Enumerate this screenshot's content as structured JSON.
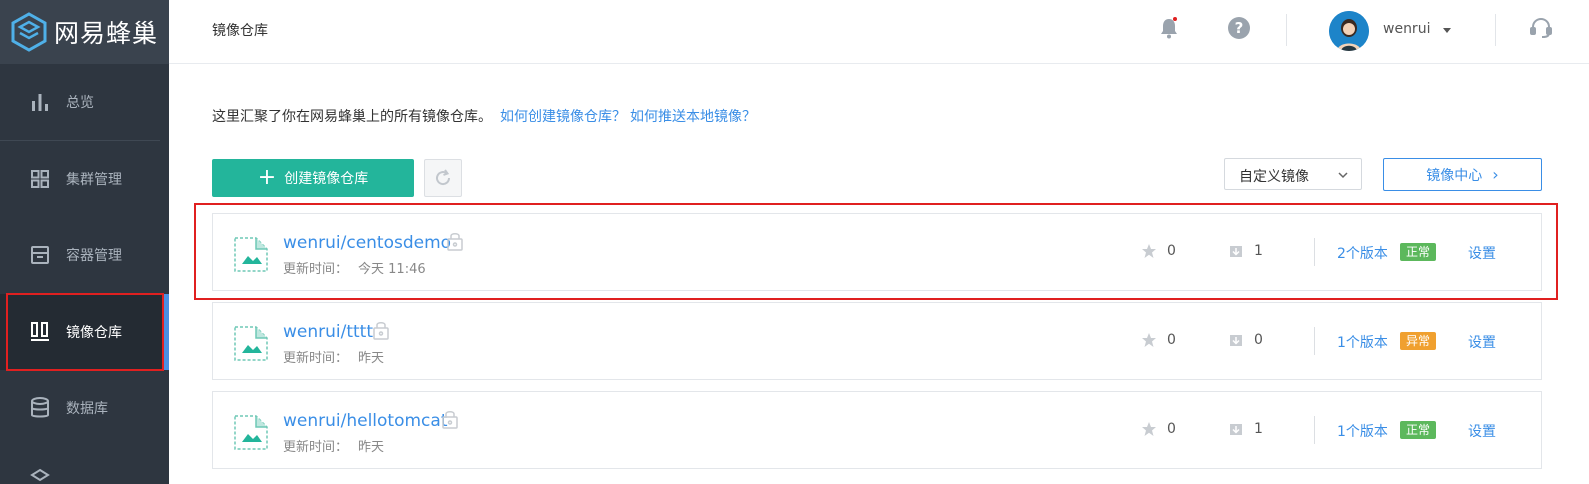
{
  "brand": {
    "name": "网易蜂巢"
  },
  "sidebar": {
    "items": [
      {
        "label": "总览",
        "icon": "bar-chart-icon"
      },
      {
        "label": "集群管理",
        "icon": "grid-icon"
      },
      {
        "label": "容器管理",
        "icon": "container-box-icon"
      },
      {
        "label": "镜像仓库",
        "icon": "image-repo-icon",
        "active": true
      },
      {
        "label": "数据库",
        "icon": "database-icon"
      }
    ]
  },
  "header": {
    "title": "镜像仓库",
    "user": {
      "name": "wenrui"
    },
    "notification_icon": "bell-icon",
    "help_icon": "help-icon",
    "support_icon": "headset-icon"
  },
  "intro": {
    "text": "这里汇聚了你在网易蜂巢上的所有镜像仓库。",
    "link1": "如何创建镜像仓库？",
    "link2": "如何推送本地镜像？"
  },
  "toolbar": {
    "create_label": "创建镜像仓库",
    "select_value": "自定义镜像",
    "center_label": "镜像中心"
  },
  "repos": [
    {
      "name": "wenrui/centosdemo",
      "time_label": "更新时间：",
      "time": "今天 11:46",
      "stars": "0",
      "pulls": "1",
      "versions": "2个版本",
      "status": "正常",
      "settings": "设置"
    },
    {
      "name": "wenrui/tttt",
      "time_label": "更新时间：",
      "time": "昨天",
      "stars": "0",
      "pulls": "0",
      "versions": "1个版本",
      "status": "异常",
      "settings": "设置"
    },
    {
      "name": "wenrui/hellotomcat",
      "time_label": "更新时间：",
      "time": "昨天",
      "stars": "0",
      "pulls": "1",
      "versions": "1个版本",
      "status": "正常",
      "settings": "设置"
    }
  ],
  "colors": {
    "accent": "#23b59b",
    "link": "#3a8ee6",
    "sidebar_bg": "#2e3640",
    "status_ok": "#5cb85c",
    "status_bad": "#f0a02f",
    "highlight": "#e02020"
  }
}
